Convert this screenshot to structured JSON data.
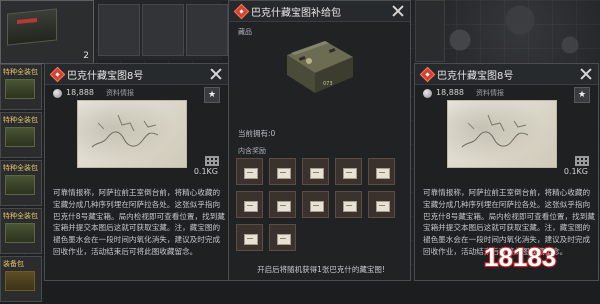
{
  "background": {
    "slot_count": "2",
    "left_slot_labels": [
      "特种全装包",
      "特种全装包",
      "特种全装包",
      "特种全装包",
      "装备包"
    ]
  },
  "left_panel": {
    "title": "巴克什藏宝图8号",
    "value": "18,888",
    "tag": "资料情报",
    "weight": "0.1KG",
    "description": "可靠情报称，阿萨拉前王室倒台前，将精心收藏的宝藏分成几种序列埋在阿萨拉各处。这张似乎指向巴克什8号藏宝箱。局内检视即可查看位置，找到藏宝箱并提交本图后这就可获取宝藏。注，藏宝图的褪色墨水会在一段时间内氧化消失，建议及时完成回收作业，活动结束后可将此图收藏留念。"
  },
  "center_panel": {
    "title": "巴克什藏宝图补给包",
    "section_label": "藏品",
    "crate_marking": "073",
    "owned": "当前拥有:0",
    "contents_label": "内含奖励",
    "bottom_note": "开启后将随机获得1张巴克什的藏宝图!"
  },
  "right_panel": {
    "title": "巴克什藏宝图8号",
    "value": "18,888",
    "tag": "资料情报",
    "weight": "0.1KG",
    "description": "可靠情报称，阿萨拉前王室倒台前，将精心收藏的宝藏分成几种序列埋在阿萨拉各处。这张似乎指向巴克什8号藏宝箱。局内检视即可查看位置，找到藏宝箱并提交本图后这就可获取宝藏。注，藏宝图的褪色墨水会在一段时间内氧化消失，建议及时完成回收作业，活动结束后可将此图收藏留念。"
  },
  "watermark": {
    "text": "18183"
  },
  "colors": {
    "accent_red": "#d8412f",
    "slot_brown": "#3a322d",
    "panel_bg": "#1e2022"
  },
  "icons": [
    "diamond-icon",
    "close-icon",
    "coin-icon",
    "star-icon",
    "grid-icon",
    "paper-icon"
  ]
}
